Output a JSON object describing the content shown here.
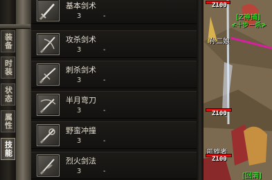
{
  "sidebar": {
    "tabs": [
      {
        "label": "装备",
        "active": false
      },
      {
        "label": "时装",
        "active": false
      },
      {
        "label": "状态",
        "active": false
      },
      {
        "label": "属性",
        "active": false
      },
      {
        "label": "技能",
        "active": true
      }
    ]
  },
  "skills": [
    {
      "name": "基本剑术",
      "level": "3",
      "key": "-",
      "icon": "sword-icon"
    },
    {
      "name": "攻杀剑术",
      "level": "3",
      "key": "-",
      "icon": "slash-icon"
    },
    {
      "name": "刺杀剑术",
      "level": "3",
      "key": "-",
      "icon": "thrust-icon"
    },
    {
      "name": "半月弯刀",
      "level": "3",
      "key": "-",
      "icon": "crescent-blade-icon"
    },
    {
      "name": "野蛮冲撞",
      "level": "3",
      "key": "-",
      "icon": "charge-icon"
    },
    {
      "name": "烈火剑法",
      "level": "3",
      "key": "-",
      "icon": "flaming-sword-icon"
    }
  ],
  "scene": {
    "players": [
      {
        "level_text": "Z100",
        "guild": "[Z神捕]",
        "guild_sub": "≮十步一杀≯",
        "name": "孙二娘"
      },
      {
        "level_text": "Z100",
        "guild": "",
        "guild_sub": "",
        "name": "凯旋者"
      },
      {
        "level_text": "Z100",
        "guild": "[回满]",
        "guild_sub": "",
        "name": ""
      }
    ],
    "colors": {
      "hp_bar": "#dd1111",
      "guild_text": "#35ff35"
    }
  }
}
